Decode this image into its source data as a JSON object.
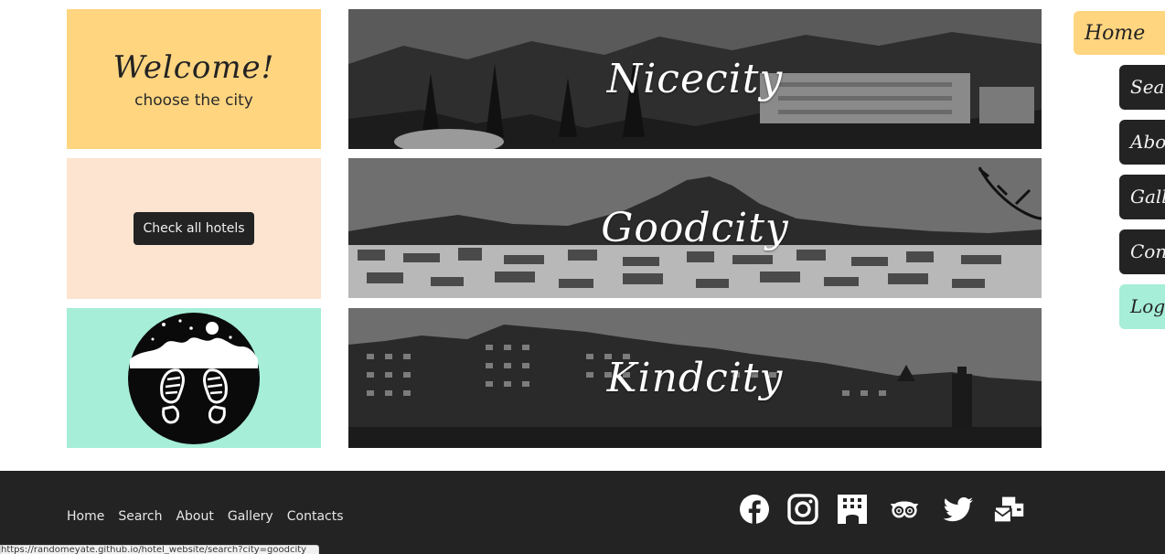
{
  "welcome": {
    "title": "Welcome!",
    "subtitle": "choose the city"
  },
  "hotels": {
    "button_label": "Check all hotels"
  },
  "logo": {
    "icon": "footprints-in-snow-icon"
  },
  "cities": [
    {
      "name": "Nicecity"
    },
    {
      "name": "Goodcity"
    },
    {
      "name": "Kindcity"
    }
  ],
  "sidenav": {
    "home": "Home",
    "items": [
      "Search",
      "About",
      "Gallery",
      "Contacts"
    ],
    "login": "Login"
  },
  "footer": {
    "links": [
      "Home",
      "Search",
      "About",
      "Gallery",
      "Contacts"
    ],
    "social": [
      "facebook-icon",
      "instagram-icon",
      "hotel-icon",
      "tripadvisor-icon",
      "twitter-icon",
      "mail-icon"
    ]
  },
  "status_url": "https://randomeyate.github.io/hotel_website/search?city=goodcity",
  "colors": {
    "yellow": "#ffd580",
    "peach": "#fde4d0",
    "mint": "#a6eed8",
    "dark": "#232323"
  }
}
